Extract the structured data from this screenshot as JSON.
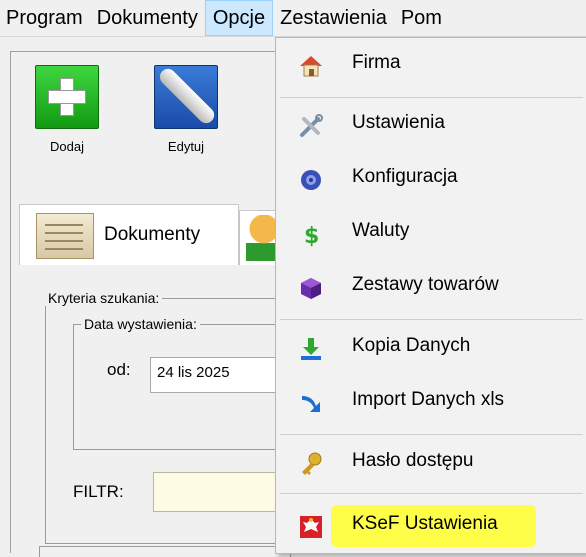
{
  "menubar": {
    "items": [
      "Program",
      "Dokumenty",
      "Opcje",
      "Zestawienia",
      "Pom"
    ]
  },
  "toolbar": {
    "add_label": "Dodaj",
    "edit_label": "Edytuj"
  },
  "tabs": {
    "documents_label": "Dokumenty"
  },
  "search": {
    "criteria_title": "Kryteria szukania:",
    "date_title": "Data wystawienia:",
    "from_label": "od:",
    "from_value": "24 lis 2025",
    "filter_label": "FILTR:",
    "filter_value": ""
  },
  "options_menu": {
    "items": [
      {
        "label": "Firma",
        "icon": "house-icon"
      },
      {
        "label": "Ustawienia",
        "icon": "tools-icon"
      },
      {
        "label": "Konfiguracja",
        "icon": "gear-icon"
      },
      {
        "label": "Waluty",
        "icon": "dollar-icon"
      },
      {
        "label": "Zestawy towarów",
        "icon": "cube-icon"
      },
      {
        "label": "Kopia Danych",
        "icon": "download-icon"
      },
      {
        "label": "Import Danych xls",
        "icon": "import-arrow-icon"
      },
      {
        "label": "Hasło dostępu",
        "icon": "key-icon"
      },
      {
        "label": "KSeF Ustawienia",
        "icon": "eagle-emblem-icon"
      }
    ]
  },
  "colors": {
    "menu_active_bg": "#cce8ff",
    "highlight": "#ffff3a",
    "filter_bg": "#fdfbe4"
  }
}
